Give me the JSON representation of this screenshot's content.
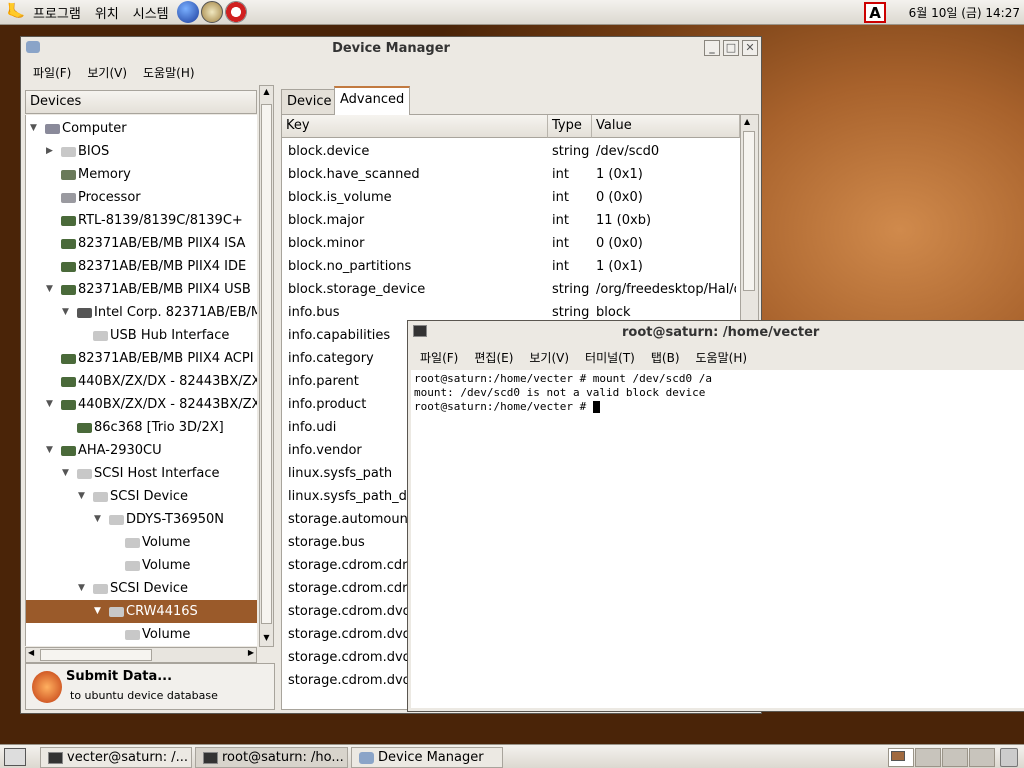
{
  "top_panel": {
    "menu": [
      "프로그램",
      "위치",
      "시스템"
    ],
    "clock": "6월 10일 (금) 14:27",
    "kbd_indicator": "A"
  },
  "dm": {
    "title": "Device Manager",
    "menu": [
      "파일(F)",
      "보기(V)",
      "도움말(H)"
    ],
    "devices_header": "Devices",
    "tree": [
      {
        "label": "Computer",
        "level": 0,
        "arrow": "open",
        "icon": "computer"
      },
      {
        "label": "BIOS",
        "level": 1,
        "arrow": "closed",
        "icon": "chip"
      },
      {
        "label": "Memory",
        "level": 1,
        "arrow": "none",
        "icon": "memory"
      },
      {
        "label": "Processor",
        "level": 1,
        "arrow": "none",
        "icon": "cpu"
      },
      {
        "label": "RTL-8139/8139C/8139C+",
        "level": 1,
        "arrow": "none",
        "icon": "card"
      },
      {
        "label": "82371AB/EB/MB PIIX4 ISA",
        "level": 1,
        "arrow": "none",
        "icon": "card"
      },
      {
        "label": "82371AB/EB/MB PIIX4 IDE",
        "level": 1,
        "arrow": "none",
        "icon": "card"
      },
      {
        "label": "82371AB/EB/MB PIIX4 USB",
        "level": 1,
        "arrow": "open",
        "icon": "card"
      },
      {
        "label": "Intel Corp. 82371AB/EB/M",
        "level": 2,
        "arrow": "open",
        "icon": "usb"
      },
      {
        "label": "USB Hub Interface",
        "level": 3,
        "arrow": "none",
        "icon": "chip"
      },
      {
        "label": "82371AB/EB/MB PIIX4 ACPI",
        "level": 1,
        "arrow": "none",
        "icon": "card"
      },
      {
        "label": "440BX/ZX/DX - 82443BX/ZX",
        "level": 1,
        "arrow": "none",
        "icon": "card"
      },
      {
        "label": "440BX/ZX/DX - 82443BX/ZX",
        "level": 1,
        "arrow": "open",
        "icon": "card"
      },
      {
        "label": "86c368 [Trio 3D/2X]",
        "level": 2,
        "arrow": "none",
        "icon": "card"
      },
      {
        "label": "AHA-2930CU",
        "level": 1,
        "arrow": "open",
        "icon": "card"
      },
      {
        "label": "SCSI Host Interface",
        "level": 2,
        "arrow": "open",
        "icon": "chip"
      },
      {
        "label": "SCSI Device",
        "level": 3,
        "arrow": "open",
        "icon": "chip"
      },
      {
        "label": "DDYS-T36950N",
        "level": 4,
        "arrow": "open",
        "icon": "chip"
      },
      {
        "label": "Volume",
        "level": 5,
        "arrow": "none",
        "icon": "chip"
      },
      {
        "label": "Volume",
        "level": 5,
        "arrow": "none",
        "icon": "chip"
      },
      {
        "label": "SCSI Device",
        "level": 3,
        "arrow": "open",
        "icon": "chip"
      },
      {
        "label": "CRW4416S",
        "level": 4,
        "arrow": "open",
        "icon": "chip",
        "selected": true
      },
      {
        "label": "Volume",
        "level": 5,
        "arrow": "none",
        "icon": "chip"
      }
    ],
    "submit": {
      "title": "Submit Data...",
      "subtitle": "to ubuntu device database"
    },
    "tabs": [
      {
        "label": "Device",
        "active": false
      },
      {
        "label": "Advanced",
        "active": true
      }
    ],
    "columns": [
      "Key",
      "Type",
      "Value"
    ],
    "rows": [
      {
        "key": "block.device",
        "type": "string",
        "value": "/dev/scd0"
      },
      {
        "key": "block.have_scanned",
        "type": "int",
        "value": "1 (0x1)"
      },
      {
        "key": "block.is_volume",
        "type": "int",
        "value": "0 (0x0)"
      },
      {
        "key": "block.major",
        "type": "int",
        "value": "11 (0xb)"
      },
      {
        "key": "block.minor",
        "type": "int",
        "value": "0 (0x0)"
      },
      {
        "key": "block.no_partitions",
        "type": "int",
        "value": "1 (0x1)"
      },
      {
        "key": "block.storage_device",
        "type": "string",
        "value": "/org/freedesktop/Hal/d"
      },
      {
        "key": "info.bus",
        "type": "string",
        "value": "block"
      },
      {
        "key": "info.capabilities",
        "type": "",
        "value": ""
      },
      {
        "key": "info.category",
        "type": "",
        "value": ""
      },
      {
        "key": "info.parent",
        "type": "",
        "value": ""
      },
      {
        "key": "info.product",
        "type": "",
        "value": ""
      },
      {
        "key": "info.udi",
        "type": "",
        "value": ""
      },
      {
        "key": "info.vendor",
        "type": "",
        "value": ""
      },
      {
        "key": "linux.sysfs_path",
        "type": "",
        "value": ""
      },
      {
        "key": "linux.sysfs_path_de",
        "type": "",
        "value": ""
      },
      {
        "key": "storage.automount",
        "type": "",
        "value": ""
      },
      {
        "key": "storage.bus",
        "type": "",
        "value": ""
      },
      {
        "key": "storage.cdrom.cdr",
        "type": "",
        "value": ""
      },
      {
        "key": "storage.cdrom.cdr",
        "type": "",
        "value": ""
      },
      {
        "key": "storage.cdrom.dvd",
        "type": "",
        "value": ""
      },
      {
        "key": "storage.cdrom.dvd",
        "type": "",
        "value": ""
      },
      {
        "key": "storage.cdrom.dvd",
        "type": "",
        "value": ""
      },
      {
        "key": "storage.cdrom.dvd",
        "type": "",
        "value": ""
      }
    ]
  },
  "term": {
    "title": "root@saturn: /home/vecter",
    "menu": [
      "파일(F)",
      "편집(E)",
      "보기(V)",
      "터미널(T)",
      "탭(B)",
      "도움말(H)"
    ],
    "lines": [
      "root@saturn:/home/vecter # mount /dev/scd0 /a",
      "mount: /dev/scd0 is not a valid block device",
      "root@saturn:/home/vecter # "
    ]
  },
  "taskbar": {
    "tasks": [
      {
        "label": "vecter@saturn: /...",
        "active": false
      },
      {
        "label": "root@saturn: /ho...",
        "active": true
      },
      {
        "label": "Device Manager",
        "active": false
      }
    ]
  },
  "colors": {
    "selection": "#9a5a2a",
    "accent": "#a8622c"
  }
}
